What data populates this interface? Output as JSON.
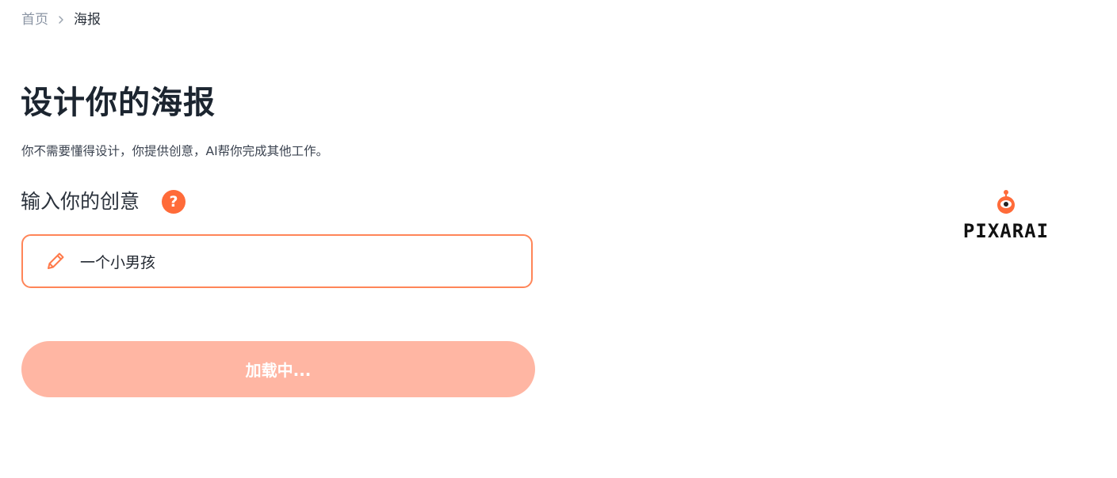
{
  "breadcrumb": {
    "home": "首页",
    "current": "海报"
  },
  "page": {
    "title": "设计你的海报",
    "subtitle": "你不需要懂得设计，你提供创意，AI帮你完成其他工作。"
  },
  "idea_section": {
    "title": "输入你的创意",
    "help_icon": "question-icon",
    "input_value": "一个小男孩",
    "input_icon": "pencil-icon"
  },
  "submit": {
    "label": "加载中..."
  },
  "logo": {
    "text": "PIXARAI",
    "mascot_icon": "robot-mascot-icon"
  },
  "colors": {
    "accent": "#ff6b39",
    "input_border": "#ff8558",
    "button_loading_bg": "#ffb6a3",
    "breadcrumb_home": "#8b95a4"
  }
}
